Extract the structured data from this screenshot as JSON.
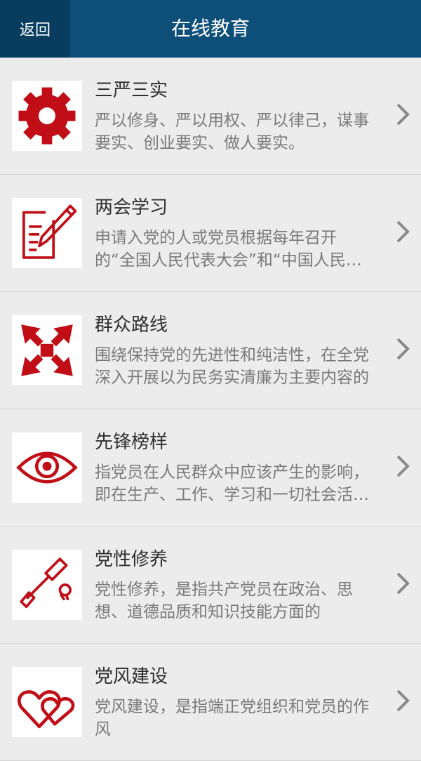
{
  "header": {
    "back_label": "返回",
    "title": "在线教育"
  },
  "items": [
    {
      "icon": "gear-icon",
      "title": "三严三实",
      "desc": "严以修身、严以用权、严以律己，谋事要实、创业要实、做人要实。"
    },
    {
      "icon": "document-pen-icon",
      "title": "两会学习",
      "desc": "申请入党的人或党员根据每年召开的“全国人民代表大会”和“中国人民政治协商会议”"
    },
    {
      "icon": "arrows-outward-icon",
      "title": "群众路线",
      "desc": "围绕保持党的先进性和纯洁性，在全党深入开展以为民务实清廉为主要内容的"
    },
    {
      "icon": "eye-icon",
      "title": "先锋榜样",
      "desc": "指党员在人民群众中应该产生的影响，即在生产、工作、学习和一切社会活动中"
    },
    {
      "icon": "screwdriver-bulb-icon",
      "title": "党性修养",
      "desc": "党性修养，是指共产党员在政治、思想、道德品质和知识技能方面的"
    },
    {
      "icon": "hearts-icon",
      "title": "党风建设",
      "desc": "党风建设，是指端正党组织和党员的作风"
    }
  ],
  "colors": {
    "header_bg": "#0e4f7a",
    "back_bg": "#093d60",
    "icon_red": "#c00d16"
  }
}
